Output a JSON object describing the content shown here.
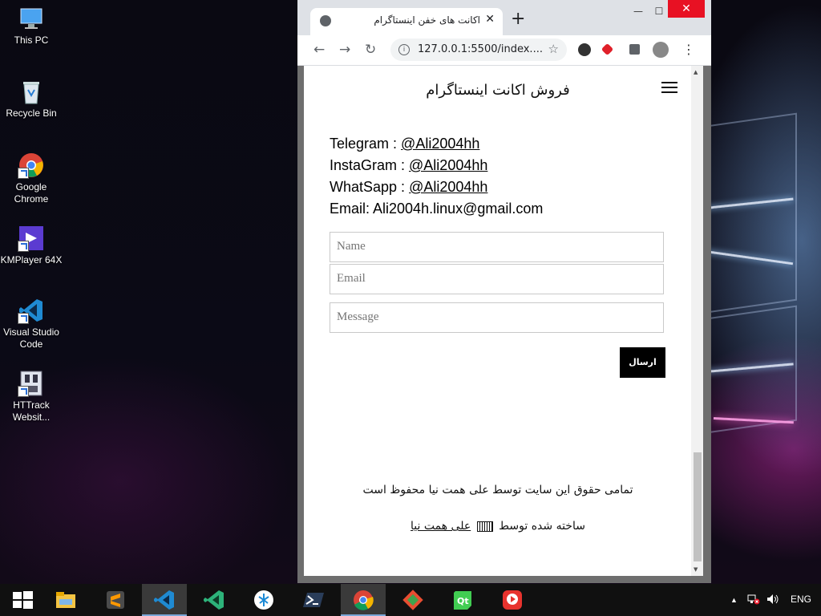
{
  "desktop": {
    "icons": [
      {
        "label": "This PC",
        "icon": "computer-icon"
      },
      {
        "label": "Recycle Bin",
        "icon": "recycle-bin-icon"
      },
      {
        "label": "Google Chrome",
        "icon": "chrome-icon"
      },
      {
        "label": "KMPlayer 64X",
        "icon": "kmplayer-icon"
      },
      {
        "label": "Visual Studio Code",
        "icon": "vscode-icon"
      },
      {
        "label": "HTTrack Websit...",
        "icon": "httrack-icon"
      }
    ]
  },
  "browser": {
    "tab_title": "اکانت های خفن اینستاگرام",
    "new_tab": "+",
    "close_tab": "✕",
    "url": "127.0.0.1:5500/index....",
    "window_controls": {
      "minimize": "—",
      "maximize": "☐",
      "close": "✕"
    }
  },
  "page": {
    "title": "فروش اکانت اینستاگرام",
    "contacts": [
      {
        "label": "Telegram : ",
        "handle": "@Ali2004hh"
      },
      {
        "label": "InstaGram : ",
        "handle": "@Ali2004hh"
      },
      {
        "label": "WhatSapp : ",
        "handle": "@Ali2004hh"
      }
    ],
    "email_line": "Email: Ali2004h.linux@gmail.com",
    "form": {
      "name_placeholder": "Name",
      "email_placeholder": "Email",
      "message_placeholder": "Message",
      "submit_label": "ارسال"
    },
    "footer": {
      "copyright": "تمامی حقوق این سایت توسط علی همت نیا محفوظ است",
      "made_by_prefix": "ساخته شده توسط",
      "author": "علی همت نیا"
    }
  },
  "taskbar": {
    "language": "ENG",
    "apps": [
      "file-explorer-icon",
      "sublime-text-icon",
      "vscode-icon",
      "visual-studio-icon",
      "pycharm-icon",
      "powershell-icon",
      "chrome-icon",
      "git-gui-icon",
      "qt-creator-icon",
      "kmplayer-plus-icon"
    ]
  },
  "colors": {
    "close_red": "#e81123",
    "tabstrip": "#dee1e6",
    "button_black": "#000000"
  }
}
